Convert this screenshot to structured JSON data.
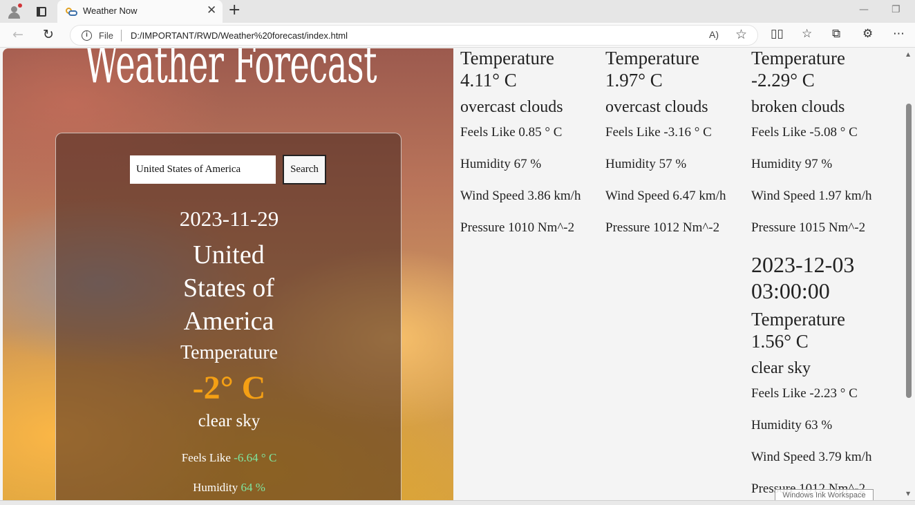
{
  "browser": {
    "tab_title": "Weather Now",
    "address_prefix": "File",
    "url": "D:/IMPORTANT/RWD/Weather%20forecast/index.html",
    "read_aloud": "A)",
    "icons": [
      "profile-icon",
      "tab-actions-icon",
      "favicon-weather",
      "close-icon",
      "new-tab-icon",
      "back-icon",
      "reload-icon",
      "info-icon",
      "favorite-star-icon",
      "split-screen-icon",
      "favorites-icon",
      "collections-icon",
      "extensions-icon",
      "more-icon"
    ]
  },
  "page": {
    "title": "Weather Forecast",
    "search": {
      "value": "United States of America",
      "button": "Search"
    },
    "current": {
      "date": "2023-11-29",
      "city": "United States of America",
      "temperature_label": "Temperature",
      "temperature": "-2° C",
      "description": "clear sky",
      "feels_like_label": "Feels Like",
      "feels_like_value": "-6.64 ° C",
      "humidity_label": "Humidity",
      "humidity_value": "64 %"
    },
    "forecast": [
      {
        "temperature_label": "Temperature",
        "temperature": "4.11° C",
        "description": "overcast clouds",
        "feels_like": "Feels Like 0.85 ° C",
        "humidity": "Humidity 67 %",
        "wind": "Wind Speed 3.86 km/h",
        "pressure": "Pressure 1010 Nm^-2"
      },
      {
        "temperature_label": "Temperature",
        "temperature": "1.97° C",
        "description": "overcast clouds",
        "feels_like": "Feels Like -3.16 ° C",
        "humidity": "Humidity 57 %",
        "wind": "Wind Speed 6.47 km/h",
        "pressure": "Pressure 1012 Nm^-2"
      },
      {
        "temperature_label": "Temperature",
        "temperature": "-2.29° C",
        "description": "broken clouds",
        "feels_like": "Feels Like -5.08 ° C",
        "humidity": "Humidity 97 %",
        "wind": "Wind Speed 1.97 km/h",
        "pressure": "Pressure 1015 Nm^-2"
      },
      {
        "date": "2023-12-03 03:00:00",
        "temperature_label": "Temperature",
        "temperature": "1.56° C",
        "description": "clear sky",
        "feels_like": "Feels Like -2.23 ° C",
        "humidity": "Humidity 63 %",
        "wind": "Wind Speed 3.79 km/h",
        "pressure": "Pressure 1012 Nm^-2"
      }
    ]
  },
  "overlay": {
    "ink_workspace": "Windows Ink Workspace"
  },
  "colors": {
    "accent_temp": "#f5a014",
    "accent_values": "#7ee6a0"
  }
}
